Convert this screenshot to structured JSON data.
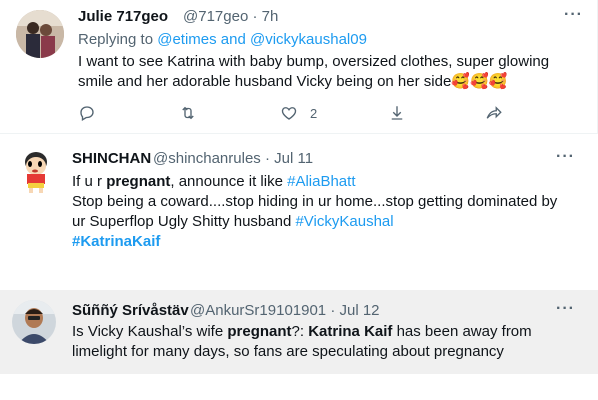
{
  "tweets": [
    {
      "name": "Julie 717geo",
      "handle": "@717geo",
      "sep": "·",
      "time": "7h",
      "reply_prefix": "Replying to ",
      "reply_to": "@etimes and @vickykaushal09",
      "text_line1": "I want to see Katrina with baby bump, oversized clothes, super glowing",
      "text_line2": "smile and her adorable husband Vicky being on her side",
      "emoji": "🥰🥰🥰",
      "likes": "2",
      "icons": [
        "reply-icon",
        "retweet-icon",
        "like-icon",
        "download-icon",
        "share-icon"
      ]
    },
    {
      "name": "SHINCHAN",
      "handle": "@shinchanrules",
      "sep": "·",
      "time": "Jul 11",
      "line1_a": "If u r ",
      "line1_b": "pregnant",
      "line1_c": ", announce it like ",
      "line1_tag": "#AliaBhatt",
      "line2": "Stop being a coward....stop hiding in ur home...stop getting dominated by",
      "line3_a": "ur Superflop Ugly Shitty husband ",
      "line3_tag": "#VickyKaushal",
      "line4_tag": "#KatrinaKaif"
    },
    {
      "name": "Sũññý Srívåstäv",
      "handle": "@AnkurSr19101901",
      "sep": "·",
      "time": "Jul 12",
      "line1_a": "Is Vicky Kaushal’s wife ",
      "line1_b": "pregnant",
      "line1_c": "?: ",
      "line1_d": "Katrina Kaif",
      "line1_e": " has been away from",
      "line2": "limelight for many days, so fans are speculating about pregnancy"
    }
  ],
  "colors": {
    "link": "#1d9bf0",
    "text": "#0f1419",
    "muted": "#536471",
    "highlight_bg": "#f0f0f0"
  }
}
